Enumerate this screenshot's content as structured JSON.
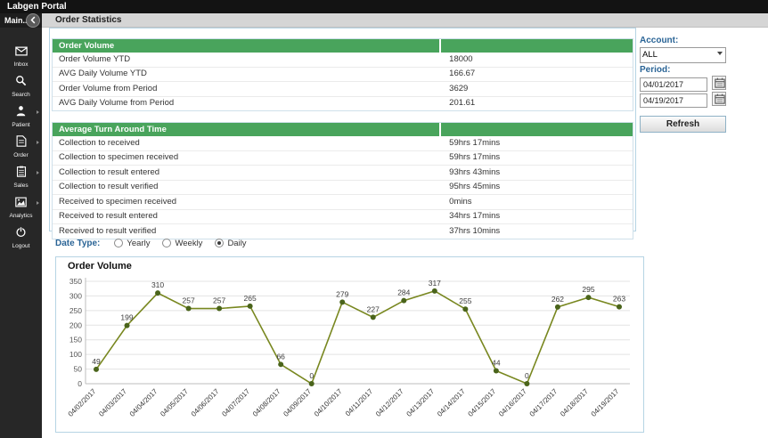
{
  "app": {
    "title": "Labgen Portal",
    "nav_label": "Main...",
    "page_title": "Order Statistics"
  },
  "sidebar": {
    "items": [
      {
        "label": "Inbox",
        "icon": "inbox-icon",
        "has_submenu": false
      },
      {
        "label": "Search",
        "icon": "search-icon",
        "has_submenu": false
      },
      {
        "label": "Patient",
        "icon": "patient-icon",
        "has_submenu": true
      },
      {
        "label": "Order",
        "icon": "order-icon",
        "has_submenu": true
      },
      {
        "label": "Sales",
        "icon": "sales-icon",
        "has_submenu": true
      },
      {
        "label": "Analytics",
        "icon": "analytics-icon",
        "has_submenu": true
      },
      {
        "label": "Logout",
        "icon": "logout-icon",
        "has_submenu": false
      }
    ]
  },
  "order_volume_table": {
    "header": "Order Volume",
    "rows": [
      {
        "label": "Order Volume YTD",
        "value": "18000"
      },
      {
        "label": "AVG Daily Volume YTD",
        "value": "166.67"
      },
      {
        "label": "Order Volume from Period",
        "value": "3629"
      },
      {
        "label": "AVG Daily Volume from Period",
        "value": "201.61"
      }
    ]
  },
  "turnaround_table": {
    "header": "Average Turn Around Time",
    "rows": [
      {
        "label": "Collection to received",
        "value": "59hrs 17mins"
      },
      {
        "label": "Collection to specimen received",
        "value": "59hrs 17mins"
      },
      {
        "label": "Collection to result entered",
        "value": "93hrs 43mins"
      },
      {
        "label": "Collection to result verified",
        "value": "95hrs 45mins"
      },
      {
        "label": "Received to specimen received",
        "value": "0mins"
      },
      {
        "label": "Received to result entered",
        "value": "34hrs 17mins"
      },
      {
        "label": "Received to result verified",
        "value": "37hrs 10mins"
      }
    ]
  },
  "date_type": {
    "label": "Date Type:",
    "options": [
      {
        "label": "Yearly",
        "selected": false
      },
      {
        "label": "Weekly",
        "selected": false
      },
      {
        "label": "Daily",
        "selected": true
      }
    ]
  },
  "filters": {
    "account_label": "Account:",
    "account_value": "ALL",
    "period_label": "Period:",
    "period_from": "04/01/2017",
    "period_to": "04/19/2017",
    "refresh_label": "Refresh"
  },
  "chart_data": {
    "type": "line",
    "title": "Order Volume",
    "x": [
      "04/02/2017",
      "04/03/2017",
      "04/04/2017",
      "04/05/2017",
      "04/06/2017",
      "04/07/2017",
      "04/08/2017",
      "04/09/2017",
      "04/10/2017",
      "04/11/2017",
      "04/12/2017",
      "04/13/2017",
      "04/14/2017",
      "04/15/2017",
      "04/16/2017",
      "04/17/2017",
      "04/18/2017",
      "04/19/2017"
    ],
    "values": [
      49,
      199,
      310,
      257,
      257,
      265,
      66,
      0,
      279,
      227,
      284,
      317,
      255,
      44,
      0,
      262,
      295,
      263
    ],
    "ylim": [
      0,
      350
    ],
    "yticks": [
      0,
      50,
      100,
      150,
      200,
      250,
      300,
      350
    ],
    "xlabel": "",
    "ylabel": "",
    "grid": true,
    "legend": "none",
    "line_color": "#78871f",
    "marker_color": "#4a641b",
    "label_color": "#3c3c3c"
  }
}
